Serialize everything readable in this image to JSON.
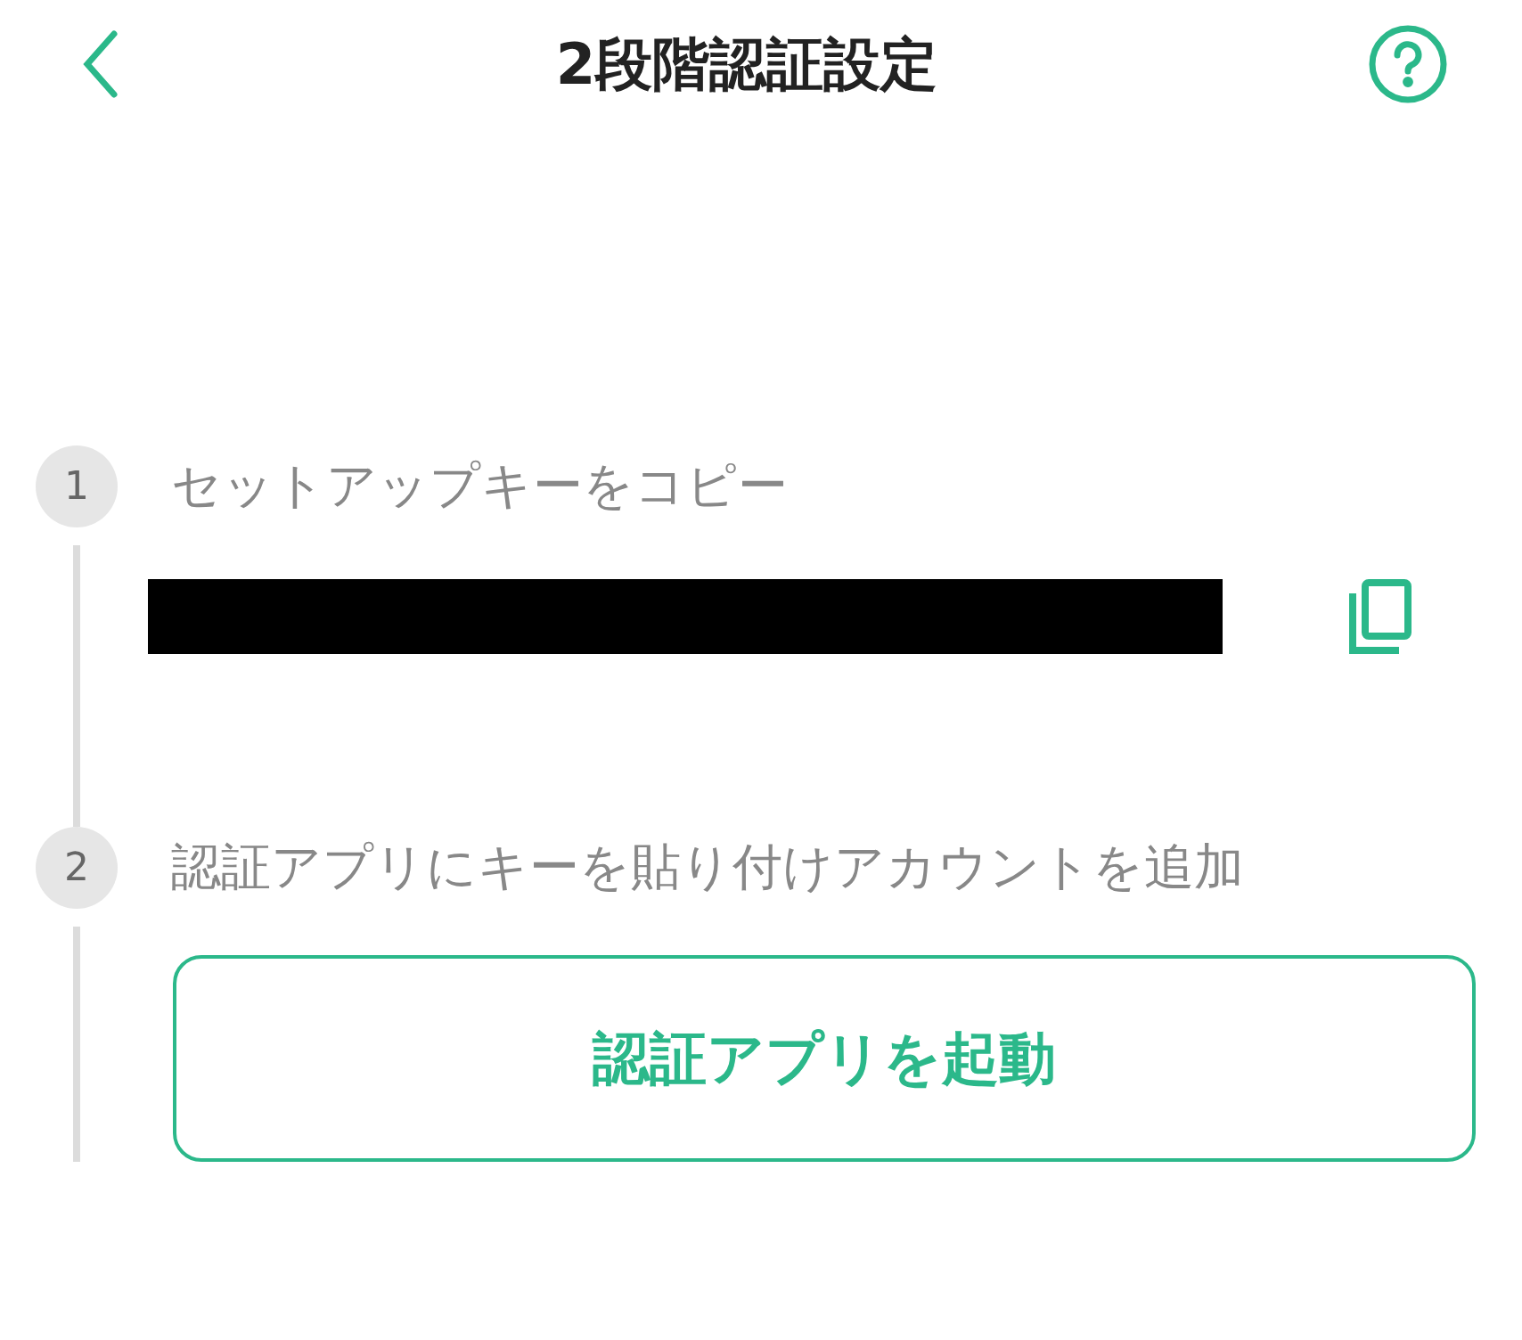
{
  "header": {
    "title": "2段階認証設定"
  },
  "steps": [
    {
      "number": "1",
      "label": "セットアップキーをコピー",
      "kind": "key"
    },
    {
      "number": "2",
      "label": "認証アプリにキーを貼り付けアカウントを追加",
      "kind": "launch",
      "button": "認証アプリを起動"
    }
  ]
}
